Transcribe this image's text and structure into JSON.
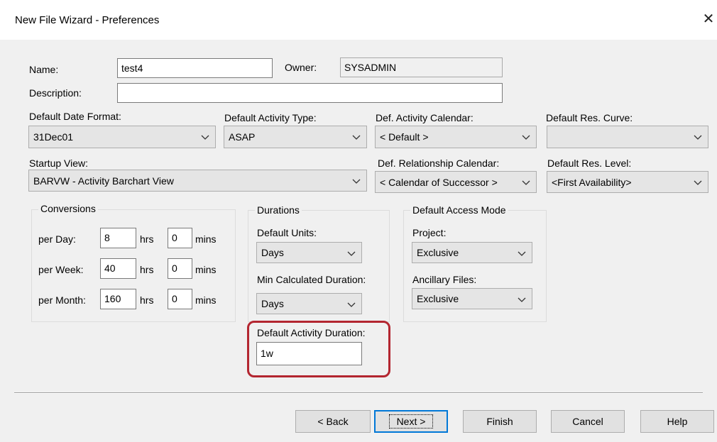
{
  "window": {
    "title": "New File Wizard - Preferences",
    "close_glyph": "✕"
  },
  "general": {
    "name_label": "Name:",
    "name_value": "test4",
    "owner_label": "Owner:",
    "owner_value": "SYSADMIN",
    "description_label": "Description:",
    "description_value": ""
  },
  "defaults": {
    "date_format_label": "Default Date Format:",
    "date_format_value": "31Dec01",
    "activity_type_label": "Default Activity Type:",
    "activity_type_value": "ASAP",
    "activity_calendar_label": "Def. Activity Calendar:",
    "activity_calendar_value": "< Default >",
    "res_curve_label": "Default Res. Curve:",
    "res_curve_value": "",
    "startup_view_label": "Startup View:",
    "startup_view_value": "BARVW - Activity Barchart View",
    "relationship_calendar_label": "Def. Relationship Calendar:",
    "relationship_calendar_value": "< Calendar of Successor >",
    "res_level_label": "Default Res. Level:",
    "res_level_value": "<First Availability>"
  },
  "conversions": {
    "title": "Conversions",
    "hrs_label": "hrs",
    "mins_label": "mins",
    "rows": [
      {
        "label": "per Day:",
        "hrs": "8",
        "mins": "0"
      },
      {
        "label": "per Week:",
        "hrs": "40",
        "mins": "0"
      },
      {
        "label": "per Month:",
        "hrs": "160",
        "mins": "0"
      }
    ]
  },
  "durations": {
    "title": "Durations",
    "units_label": "Default Units:",
    "units_value": "Days",
    "min_calc_label": "Min Calculated Duration:",
    "min_calc_value": "Days",
    "activity_duration_label": "Default Activity Duration:",
    "activity_duration_value": "1w"
  },
  "access": {
    "title": "Default Access Mode",
    "project_label": "Project:",
    "project_value": "Exclusive",
    "ancillary_label": "Ancillary Files:",
    "ancillary_value": "Exclusive"
  },
  "buttons": {
    "back": "< Back",
    "next": "Next >",
    "finish": "Finish",
    "cancel": "Cancel",
    "help": "Help"
  },
  "colors": {
    "highlight": "#b32630",
    "focus": "#0078d7"
  }
}
